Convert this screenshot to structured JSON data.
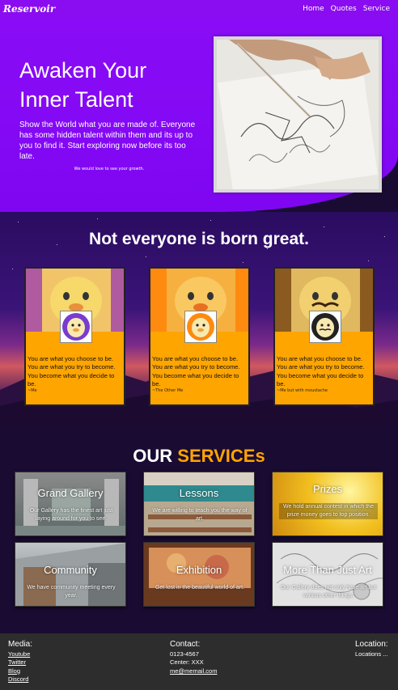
{
  "nav": {
    "brand": "Reservoir",
    "links": [
      "Home",
      "Quotes",
      "Service"
    ]
  },
  "hero": {
    "title": "Awaken Your Inner Talent",
    "subtitle": "Show the World what you are made of. Everyone has some hidden talent within them and its up to you to find it. Start exploring now before its too late.",
    "note": "We would love to see your growth."
  },
  "quotes": {
    "title": "Not everyone is born great.",
    "cards": [
      {
        "text": "You are what you choose to be. You are what you try to become. You become what you decide to be.",
        "author": "~Me",
        "tint": "#b05aa0",
        "avatar_color": "#7a3bd0"
      },
      {
        "text": "You are what you choose to be. You are what you try to become. You become what you decide to be.",
        "author": "~The Other Me",
        "tint": "#ff8a10",
        "avatar_color": "#ff8a10"
      },
      {
        "text": "You are what you choose to be. You are what you try to become. You become what you decide to be.",
        "author": "~Me but with moustache",
        "tint": "#8a5a20",
        "avatar_color": "#222222"
      }
    ]
  },
  "services": {
    "title_prefix": "OUR",
    "title_highlight": "SERVICEs",
    "items": [
      {
        "label": "Grand Gallery",
        "desc": "Our Gallery has the finest art just laying around for you to see."
      },
      {
        "label": "Lessons",
        "desc": "We are willing to teach you the way of art."
      },
      {
        "label": "Prizes",
        "desc": "We hold annual contest in which the prize money goes to top position."
      },
      {
        "label": "Community",
        "desc": "We have community meeting every year."
      },
      {
        "label": "Exhibition",
        "desc": "Get lost in the beautiful world of art."
      },
      {
        "label": "More Than Just Art",
        "desc": "Our Gallery does not only have art but various other things."
      }
    ]
  },
  "footer": {
    "media": {
      "heading": "Media:",
      "links": [
        "Youtube",
        "Twitter",
        "Blog",
        "Discord"
      ]
    },
    "contact": {
      "heading": "Contact:",
      "phone": "0123-4567",
      "center": "Center: XXX",
      "email": "me@memail.com"
    },
    "location": {
      "heading": "Location:",
      "value": "Locations ..."
    }
  },
  "colors": {
    "accent_purple": "#8a0cf0",
    "accent_orange": "#ffa500",
    "footer_bg": "#2d2d2d"
  }
}
